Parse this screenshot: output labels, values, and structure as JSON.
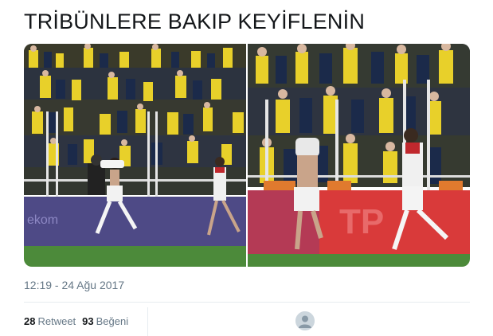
{
  "tweet": {
    "text": "TRİBÜNLERE BAKIP KEYİFLENİN",
    "timestamp": "12:19 - 24 Ağu 2017"
  },
  "stats": {
    "retweet_count": "28",
    "retweet_label": "Retweet",
    "like_count": "93",
    "like_label": "Beğeni"
  },
  "colors": {
    "text_primary": "#14171a",
    "text_secondary": "#657786",
    "divider": "#e6ecf0",
    "pitch": "#4c8a3a",
    "board_left": "#4e4a86",
    "board_right": "#d93a3a",
    "fan_yellow": "#e8d02a",
    "fan_navy": "#1b2a4a"
  },
  "media": {
    "photos": [
      {
        "icon": "football-celebration-photo"
      },
      {
        "icon": "football-celebration-photo"
      }
    ]
  }
}
